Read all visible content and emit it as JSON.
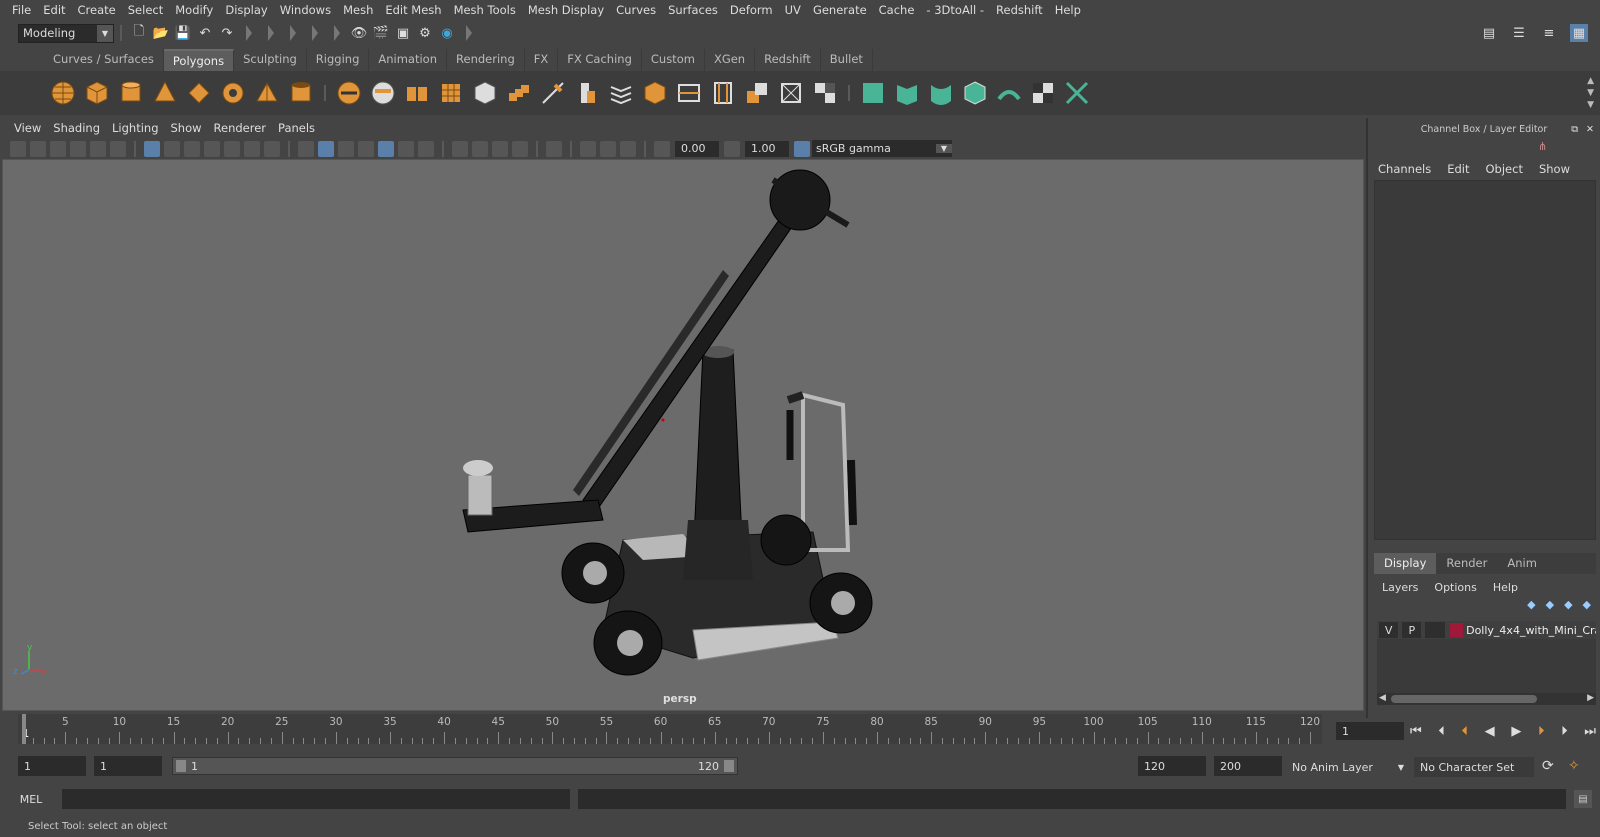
{
  "menubar": {
    "items": [
      "File",
      "Edit",
      "Create",
      "Select",
      "Modify",
      "Display",
      "Windows",
      "Mesh",
      "Edit Mesh",
      "Mesh Tools",
      "Mesh Display",
      "Curves",
      "Surfaces",
      "Deform",
      "UV",
      "Generate",
      "Cache",
      "- 3DtoAll -",
      "Redshift",
      "Help"
    ]
  },
  "statusline": {
    "mode": "Modeling"
  },
  "shelf": {
    "tabs": [
      "Curves / Surfaces",
      "Polygons",
      "Sculpting",
      "Rigging",
      "Animation",
      "Rendering",
      "FX",
      "FX Caching",
      "Custom",
      "XGen",
      "Redshift",
      "Bullet"
    ],
    "active_tab": "Polygons"
  },
  "viewport": {
    "menu": [
      "View",
      "Shading",
      "Lighting",
      "Show",
      "Renderer",
      "Panels"
    ],
    "exposure": "0.00",
    "gamma": "1.00",
    "color_space": "sRGB gamma",
    "camera": "persp"
  },
  "channelbox": {
    "title": "Channel Box / Layer Editor",
    "menu": [
      "Channels",
      "Edit",
      "Object",
      "Show"
    ]
  },
  "layereditor": {
    "tabs": [
      "Display",
      "Render",
      "Anim"
    ],
    "active_tab": "Display",
    "menu": [
      "Layers",
      "Options",
      "Help"
    ],
    "layer": {
      "v": "V",
      "p": "P",
      "name": "Dolly_4x4_with_Mini_Cra",
      "color": "#a0183a"
    }
  },
  "timeslider": {
    "ticks": [
      "1",
      "5",
      "10",
      "15",
      "20",
      "25",
      "30",
      "35",
      "40",
      "45",
      "50",
      "55",
      "60",
      "65",
      "70",
      "75",
      "80",
      "85",
      "90",
      "95",
      "100",
      "105",
      "110",
      "115",
      "120"
    ],
    "current_frame": "1"
  },
  "range": {
    "start": "1",
    "anim_start": "1",
    "slider_start": "1",
    "slider_end": "120",
    "end": "120",
    "anim_end": "200",
    "anim_layer": "No Anim Layer",
    "character_set": "No Character Set"
  },
  "commandline": {
    "label": "MEL"
  },
  "helpline": {
    "text": "Select Tool: select an object"
  },
  "colors": {
    "accent": "#5a7fa8",
    "shelf_orange": "#e0953a",
    "shelf_green": "#4ab596"
  }
}
